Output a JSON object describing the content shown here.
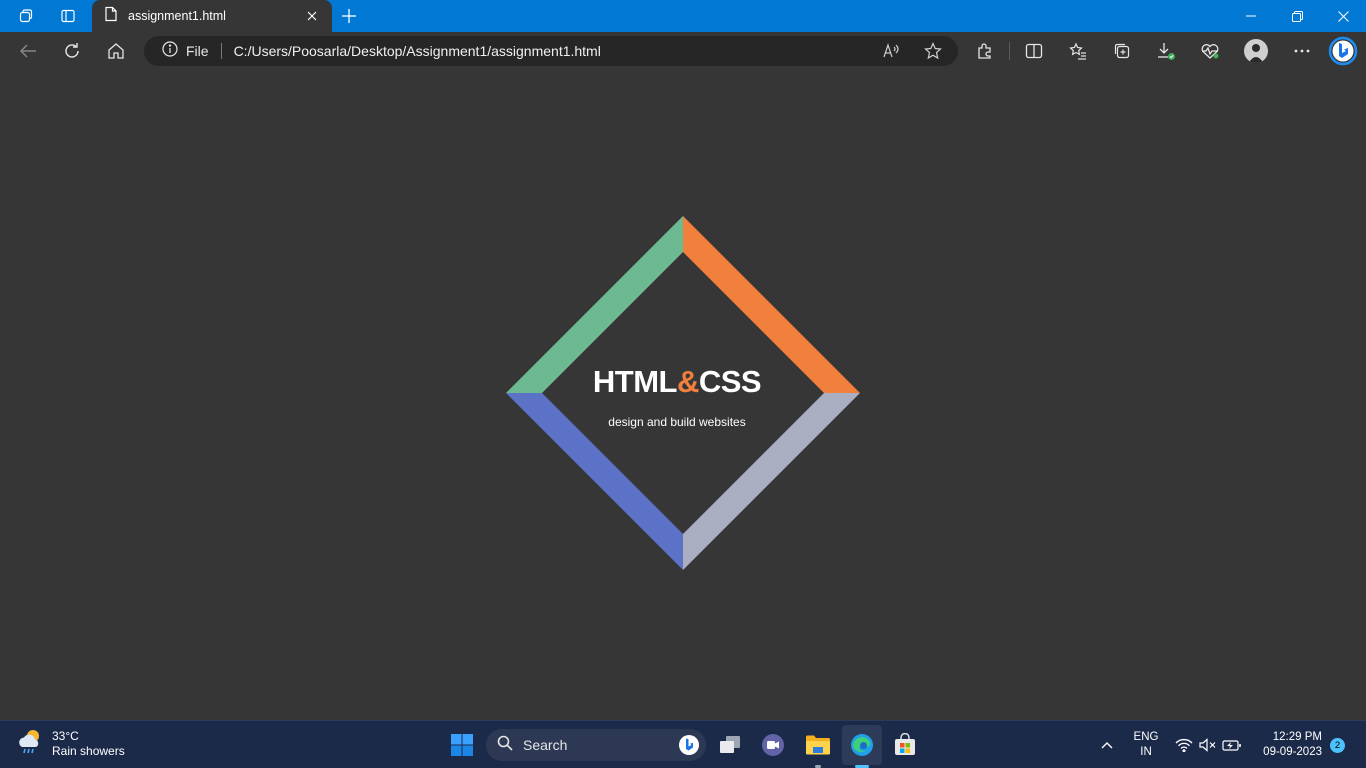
{
  "browser": {
    "tab": {
      "title": "assignment1.html"
    },
    "address": {
      "scheme_label": "File",
      "url": "C:/Users/Poosarla/Desktop/Assignment1/assignment1.html"
    }
  },
  "page": {
    "logo_part1": "HTML",
    "logo_amp": "&",
    "logo_part2": "CSS",
    "subtitle": "design and build websites",
    "colors": {
      "green": "#6dba92",
      "orange": "#f0803c",
      "blue": "#5b72c6",
      "gray": "#a9aec0",
      "background": "#363636"
    }
  },
  "taskbar": {
    "weather": {
      "temp": "33°C",
      "condition": "Rain showers"
    },
    "search_label": "Search",
    "language": {
      "line1": "ENG",
      "line2": "IN"
    },
    "clock": {
      "time": "12:29 PM",
      "date": "09-09-2023"
    },
    "notification_count": "2"
  }
}
